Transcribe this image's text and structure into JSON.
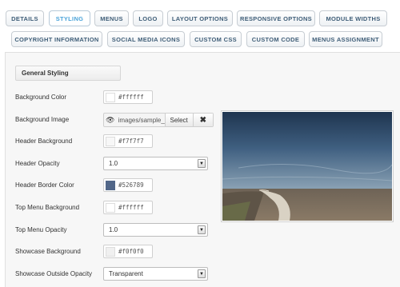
{
  "tabs": [
    {
      "label": "DETAILS",
      "active": false
    },
    {
      "label": "STYLING",
      "active": true
    },
    {
      "label": "MENUS",
      "active": false
    },
    {
      "label": "LOGO",
      "active": false
    },
    {
      "label": "LAYOUT OPTIONS",
      "active": false
    },
    {
      "label": "RESPONSIVE OPTIONS",
      "active": false
    },
    {
      "label": "MODULE WIDTHS",
      "active": false
    },
    {
      "label": "COPYRIGHT INFORMATION",
      "active": false
    },
    {
      "label": "SOCIAL MEDIA ICONS",
      "active": false
    },
    {
      "label": "CUSTOM CSS",
      "active": false
    },
    {
      "label": "CUSTOM CODE",
      "active": false
    },
    {
      "label": "MENUS ASSIGNMENT",
      "active": false
    }
  ],
  "section": {
    "title": "General Styling"
  },
  "fields": {
    "background_color": {
      "label": "Background Color",
      "value": "#ffffff",
      "swatch": "#ffffff"
    },
    "background_image": {
      "label": "Background Image",
      "value": "images/sample_",
      "select_label": "Select",
      "clear_label": "✖"
    },
    "header_background": {
      "label": "Header Background",
      "value": "#f7f7f7",
      "swatch": "#f7f7f7"
    },
    "header_opacity": {
      "label": "Header Opacity",
      "value": "1.0"
    },
    "header_border_color": {
      "label": "Header Border Color",
      "value": "#526789",
      "swatch": "#526789"
    },
    "top_menu_background": {
      "label": "Top Menu Background",
      "value": "#ffffff",
      "swatch": "#ffffff"
    },
    "top_menu_opacity": {
      "label": "Top Menu Opacity",
      "value": "1.0"
    },
    "showcase_background": {
      "label": "Showcase Background",
      "value": "#f0f0f0",
      "swatch": "#f0f0f0"
    },
    "showcase_outside_opacity": {
      "label": "Showcase Outside Opacity",
      "value": "Transparent"
    }
  },
  "colors": {
    "tab_text": "#3f5e78",
    "tab_active_text": "#4aa3d9",
    "panel_bg": "#f7f7f7"
  }
}
